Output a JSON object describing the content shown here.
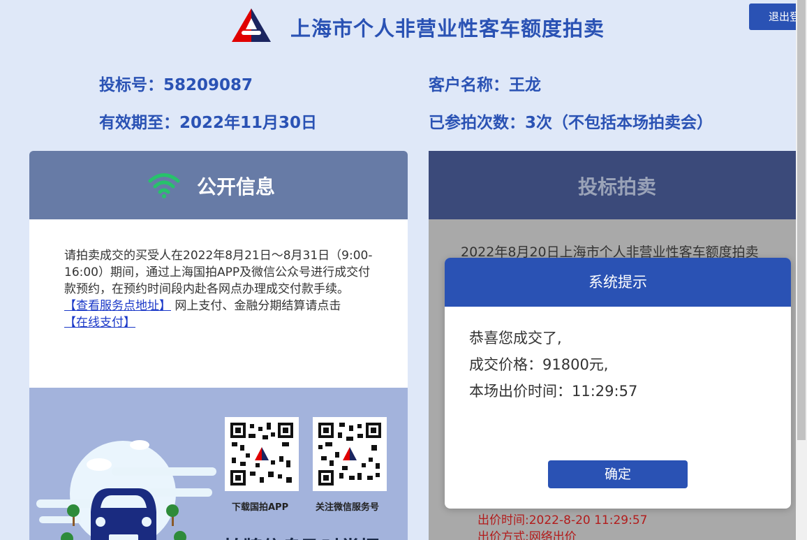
{
  "header": {
    "title": "上海市个人非营业性客车额度拍卖",
    "logout_label": "退出登",
    "brand_colors": {
      "blue": "#2a52b4",
      "red": "#e00000",
      "navy": "#1b2560"
    }
  },
  "bidder": {
    "bid_number": "投标号：58209087",
    "customer_name": "客户名称：王龙",
    "valid_until": "有效期至：2022年11月30日",
    "participation_count": "已参拍次数：3次（不包括本场拍卖会）"
  },
  "public_info": {
    "heading": "公开信息",
    "notice_text": "请拍卖成交的买受人在2022年8月21日～8月31日（9:00-16:00）期间，通过上海国拍APP及微信公众号进行成交付款预约，在预约时间段内赴各网点办理成交付款手续。",
    "service_link": "【查看服务点地址】",
    "payment_text": " 网上支付、金融分期结算请点击",
    "online_pay_link": "【在线支付】",
    "qr_app_caption": "下载国拍APP",
    "qr_wechat_caption": "关注微信服务号",
    "promo_heading": "拍牌信息及时掌握"
  },
  "auction": {
    "heading": "投标拍卖",
    "auction_title": "2022年8月20日上海市个人非营业性客车额度拍卖",
    "bid_time": "出价时间:2022-8-20 11:29:57",
    "bid_method": "出价方式:网络出价"
  },
  "modal": {
    "title": "系统提示",
    "line1": "恭喜您成交了,",
    "line2": "成交价格：91800元,",
    "line3": "本场出价时间：11:29:57",
    "confirm_label": "确定"
  }
}
